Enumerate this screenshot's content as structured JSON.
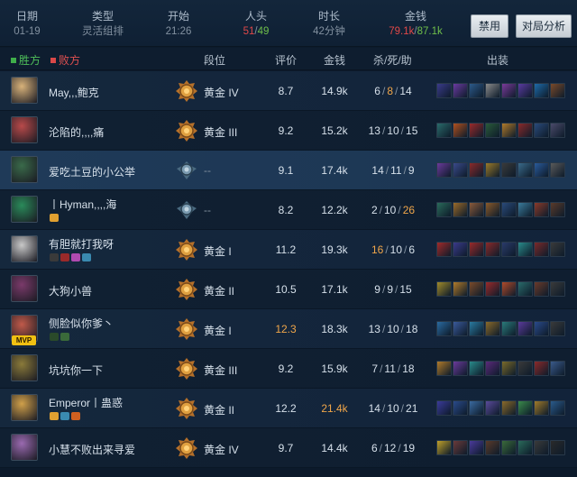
{
  "summary": {
    "date": {
      "label": "日期",
      "value": "01-19"
    },
    "type": {
      "label": "类型",
      "value": "灵活组排"
    },
    "start": {
      "label": "开始",
      "value": "21:26"
    },
    "kills": {
      "label": "人头",
      "red": "51",
      "sep": "/",
      "green": "49"
    },
    "duration": {
      "label": "时长",
      "value": "42分钟"
    },
    "gold": {
      "label": "金钱",
      "red": "79.1k",
      "sep": "/",
      "green": "87.1k"
    },
    "ban_button": "禁用",
    "analysis_button": "对局分析"
  },
  "columns": {
    "win_team": "胜方",
    "lose_team": "败方",
    "rank": "段位",
    "score": "评价",
    "gold": "金钱",
    "kda": "杀/死/助",
    "items": "出装"
  },
  "colors": {
    "win": "#3fae4a",
    "lose": "#d94848",
    "highlight_value": "#f0a64a",
    "mvp": "#f0c012"
  },
  "players": [
    {
      "name": "May,,,鲍克",
      "rank": "黄金 IV",
      "rank_icon": "gold-rank",
      "score": "8.7",
      "gold": "14.9k",
      "k": "6",
      "d": "8",
      "a": "14",
      "hi_d": true,
      "champ_color": "#d8b27a",
      "badges": [],
      "mvp": "",
      "items": [
        "#3a3a8a",
        "#6a3aa0",
        "#2c5a8a",
        "#8a8a8a",
        "#7a3a9a",
        "#5a3aa0",
        "#1e6aa8",
        "#7a4a2a"
      ]
    },
    {
      "name": "沦陷的,,,,痛",
      "rank": "黄金 III",
      "rank_icon": "gold-rank",
      "score": "9.2",
      "gold": "15.2k",
      "k": "13",
      "d": "10",
      "a": "15",
      "champ_color": "#b84a4a",
      "badges": [],
      "mvp": "",
      "items": [
        "#2a6a6a",
        "#b0501e",
        "#9a2a2a",
        "#2a5a3a",
        "#b07a2a",
        "#8a2a2a",
        "#2a4a7a",
        "#4a4a6a"
      ]
    },
    {
      "name": "爱吃土豆的小公举",
      "rank": "--",
      "rank_icon": "silver-rank",
      "score": "9.1",
      "gold": "17.4k",
      "k": "14",
      "d": "11",
      "a": "9",
      "champ_color": "#3a6a4a",
      "highlight": true,
      "badges": [],
      "mvp": "",
      "items": [
        "#6a3a9a",
        "#3a4a8a",
        "#8a2a2a",
        "#9a7a2a",
        "#3a3a3a",
        "#3a6a8a",
        "#2a5a9a",
        "#5a5a5a"
      ]
    },
    {
      "name": "丨Hyman,,,,海",
      "rank": "--",
      "rank_icon": "silver-rank",
      "score": "8.2",
      "gold": "12.2k",
      "k": "2",
      "d": "10",
      "a": "26",
      "hi_a": true,
      "champ_color": "#2a8a5a",
      "badges": [
        "#e0a030"
      ],
      "mvp": "",
      "items": [
        "#2a6a5a",
        "#9a6a2a",
        "#8a5a3a",
        "#8a5a2a",
        "#2a4a7a",
        "#3a7a9a",
        "#8a3a2a",
        "#5a3a2a"
      ]
    },
    {
      "name": "有胆就打我呀",
      "rank": "黄金 I",
      "rank_icon": "gold-rank",
      "score": "11.2",
      "gold": "19.3k",
      "k": "16",
      "d": "10",
      "a": "6",
      "hi_k": true,
      "champ_color": "#c8c8c8",
      "badges": [
        "#3a3a3a",
        "#9a2a2a",
        "#b04ab0",
        "#3a8ab0"
      ],
      "mvp": "",
      "items": [
        "#a02a2a",
        "#3a3a8a",
        "#9a2a2a",
        "#8a2a2a",
        "#2a3a6a",
        "#2a8a8a",
        "#7a2a2a",
        "#3a3a3a"
      ]
    },
    {
      "name": "大狗小兽",
      "rank": "黄金 II",
      "rank_icon": "gold-rank",
      "score": "10.5",
      "gold": "17.1k",
      "k": "9",
      "d": "9",
      "a": "15",
      "champ_color": "#7a3a6a",
      "badges": [],
      "mvp": "",
      "items": [
        "#a08a2a",
        "#b07a2a",
        "#7a4a2a",
        "#9a2a2a",
        "#b04a2a",
        "#2a6a6a",
        "#6a3a2a",
        "#3a3a3a"
      ]
    },
    {
      "name": "侧脸似你爹丶",
      "rank": "黄金 I",
      "rank_icon": "gold-rank",
      "score": "12.3",
      "gold": "18.3k",
      "k": "13",
      "d": "10",
      "a": "18",
      "hi_score": true,
      "champ_color": "#c05a4a",
      "badges": [
        "#2a4a2a",
        "#3a6a3a"
      ],
      "mvp": "MVP",
      "items": [
        "#2a6aa0",
        "#3a5a9a",
        "#2a7aa0",
        "#8a6a2a",
        "#2a7a7a",
        "#5a3a9a",
        "#2a4a8a",
        "#3a3a3a"
      ]
    },
    {
      "name": "坑坑你一下",
      "rank": "黄金 III",
      "rank_icon": "gold-rank",
      "score": "9.2",
      "gold": "15.9k",
      "k": "7",
      "d": "11",
      "a": "18",
      "champ_color": "#8a7a3a",
      "badges": [],
      "mvp": "",
      "items": [
        "#b07a2a",
        "#6a3a9a",
        "#2a8a8a",
        "#5a2a7a",
        "#7a6a2a",
        "#3a3a3a",
        "#8a2a2a",
        "#3a5a8a"
      ]
    },
    {
      "name": "Emperor丨蛊惑",
      "rank": "黄金 II",
      "rank_icon": "gold-rank",
      "score": "12.2",
      "gold": "21.4k",
      "k": "14",
      "d": "10",
      "a": "21",
      "hi_gold": true,
      "champ_color": "#d0a04a",
      "badges": [
        "#e0a030",
        "#3a8ab0",
        "#d06020"
      ],
      "mvp": "",
      "items": [
        "#3a3a9a",
        "#2a4a8a",
        "#3a6aa0",
        "#5a4a9a",
        "#8a6a2a",
        "#3a8a4a",
        "#a07a2a",
        "#2a5a8a"
      ]
    },
    {
      "name": "小慧不败出来寻爱",
      "rank": "黄金 IV",
      "rank_icon": "gold-rank",
      "score": "9.7",
      "gold": "14.4k",
      "k": "6",
      "d": "12",
      "a": "19",
      "champ_color": "#9a6ab0",
      "badges": [],
      "mvp": "",
      "items": [
        "#c0a02a",
        "#6a3a3a",
        "#4a3a9a",
        "#5a3a2a",
        "#3a6a3a",
        "#2a6a5a",
        "#3a3a3a",
        "#2a2a2a"
      ]
    }
  ]
}
